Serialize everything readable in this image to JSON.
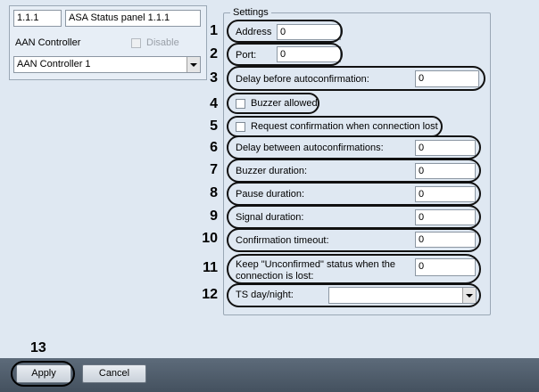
{
  "device": {
    "id": "1.1.1",
    "name": "ASA Status panel 1.1.1",
    "controller_label": "AAN Controller",
    "disable_label": "Disable",
    "controller_value": "AAN Controller 1"
  },
  "settings": {
    "group_title": "Settings",
    "address_label": "Address",
    "address_value": "0",
    "port_label": "Port:",
    "port_value": "0",
    "delay_before_label": "Delay before autoconfirmation:",
    "delay_before_value": "0",
    "buzzer_allowed_label": "Buzzer allowed",
    "request_confirmation_label": "Request confirmation when connection lost",
    "delay_between_label": "Delay between autoconfirmations:",
    "delay_between_value": "0",
    "buzzer_duration_label": "Buzzer duration:",
    "buzzer_duration_value": "0",
    "pause_duration_label": "Pause duration:",
    "pause_duration_value": "0",
    "signal_duration_label": "Signal duration:",
    "signal_duration_value": "0",
    "confirmation_timeout_label": "Confirmation timeout:",
    "confirmation_timeout_value": "0",
    "keep_unconfirmed_label_1": "Keep \"Unconfirmed\" status when the",
    "keep_unconfirmed_label_2": "connection is lost:",
    "keep_unconfirmed_value": "0",
    "ts_day_night_label": "TS day/night:",
    "ts_day_night_value": ""
  },
  "callouts": [
    "1",
    "2",
    "3",
    "4",
    "5",
    "6",
    "7",
    "8",
    "9",
    "10",
    "11",
    "12",
    "13"
  ],
  "footer": {
    "apply_label": "Apply",
    "cancel_label": "Cancel"
  }
}
